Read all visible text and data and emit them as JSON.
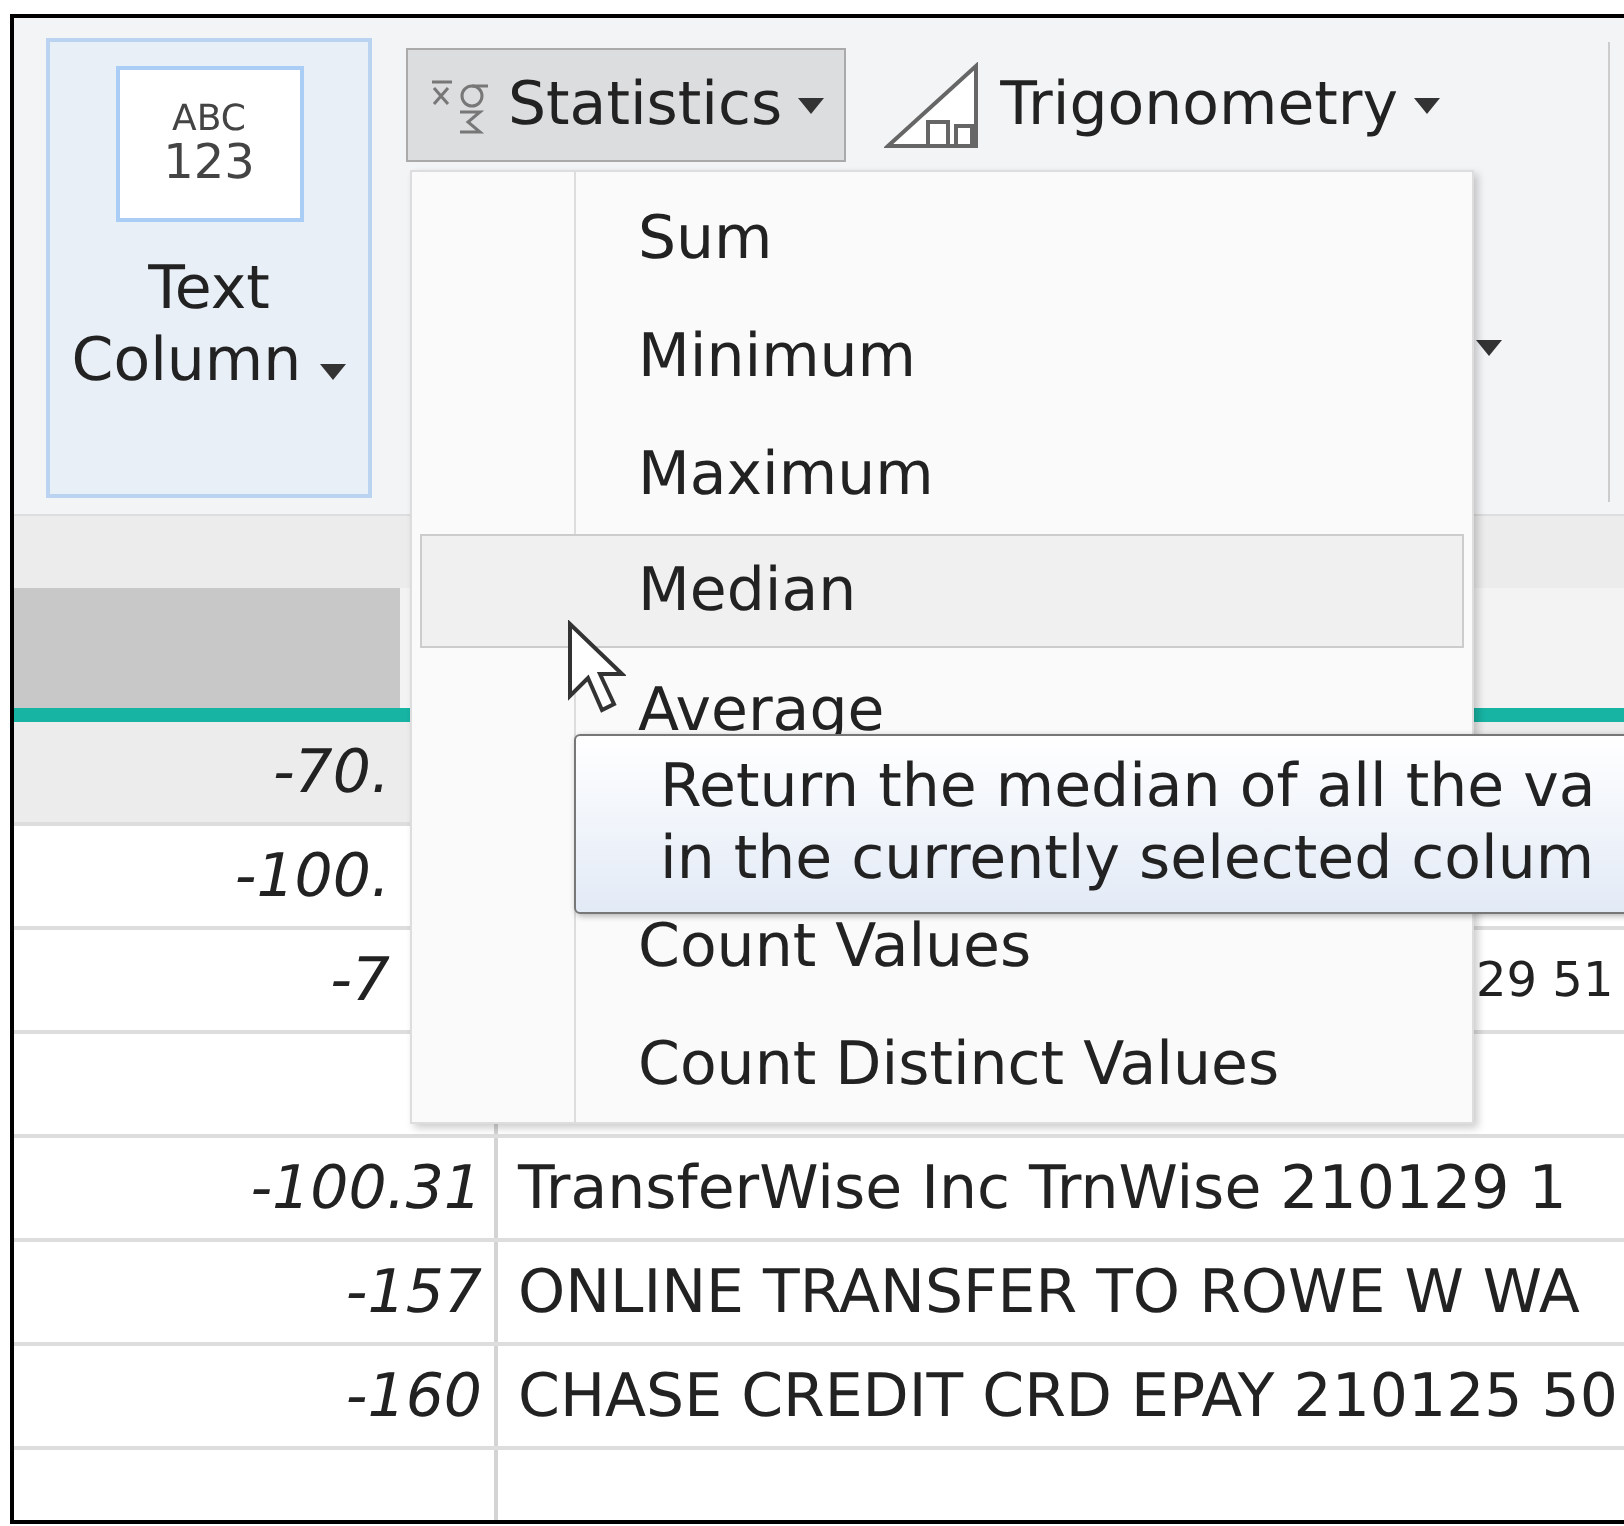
{
  "ribbon": {
    "text_column": {
      "icon_lines": [
        "ABC",
        "123"
      ],
      "label": "Text Column"
    },
    "statistics": {
      "label": "Statistics",
      "pressed": true
    },
    "trigonometry": {
      "label": "Trigonometry",
      "pressed": false
    }
  },
  "statistics_menu": {
    "items": [
      {
        "label": "Sum",
        "selected": false
      },
      {
        "label": "Minimum",
        "selected": false
      },
      {
        "label": "Maximum",
        "selected": false
      },
      {
        "label": "Median",
        "selected": true
      },
      {
        "label": "Average",
        "selected": false
      },
      {
        "label": "Count Values",
        "selected": false,
        "after_hidden_item": true
      },
      {
        "label": "Count Distinct Values",
        "selected": false
      }
    ]
  },
  "tooltip": {
    "lines": [
      "Return the median of all the va",
      "in the currently selected colum"
    ]
  },
  "table": {
    "rows": [
      {
        "amount": "-70.",
        "selected": true,
        "covered": true
      },
      {
        "amount": "-100.",
        "selected": false,
        "covered": true
      },
      {
        "amount": "-7",
        "description": "29 51",
        "selected": false,
        "covered": true
      },
      {
        "selected": false
      },
      {
        "amount": "-100.31",
        "description": "TransferWise Inc TrnWise 210129 1",
        "selected": false,
        "covered": false
      },
      {
        "amount": "-157",
        "description": "ONLINE TRANSFER TO ROWE W WA",
        "selected": false,
        "covered": false
      },
      {
        "amount": "-160",
        "description": "CHASE CREDIT CRD EPAY 210125 50",
        "selected": false,
        "covered": false
      },
      {
        "selected": false
      }
    ]
  }
}
